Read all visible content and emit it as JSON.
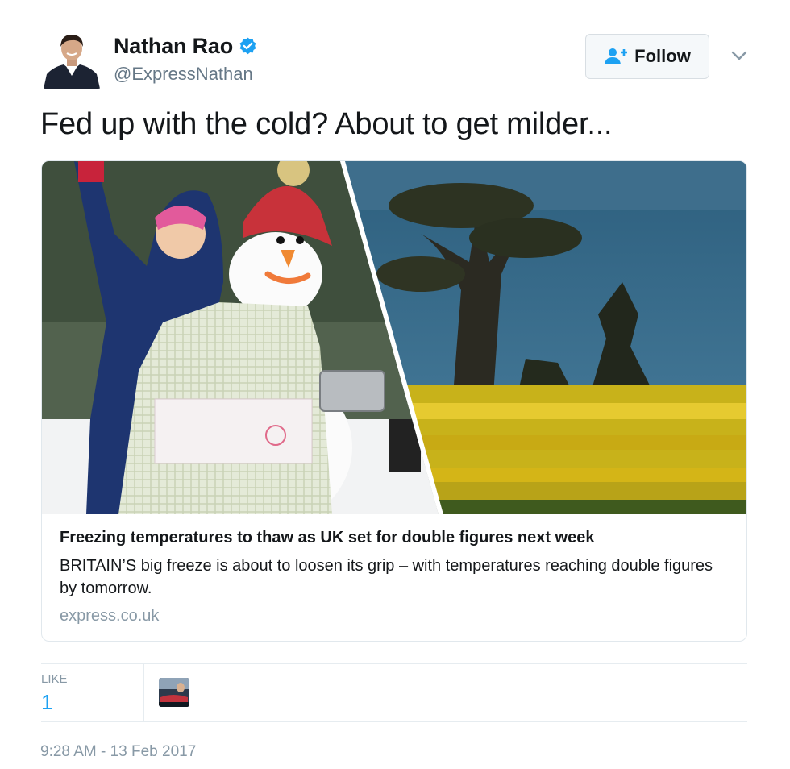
{
  "author": {
    "display_name": "Nathan Rao",
    "handle": "@ExpressNathan",
    "verified": true,
    "verified_color": "#1da1f2"
  },
  "follow_button": {
    "label": "Follow",
    "icon": "add-user-icon"
  },
  "tweet": {
    "text": "Fed up with the cold? About to get milder..."
  },
  "card": {
    "title": "Freezing temperatures to thaw as UK set for double figures next week",
    "description": "BRITAIN’S big freeze is about to loosen its grip – with temperatures reaching double figures by tomorrow.",
    "domain": "express.co.uk"
  },
  "stats": {
    "likes_label": "LIKE",
    "likes_count": "1"
  },
  "timestamp": "9:28 AM - 13 Feb 2017",
  "colors": {
    "accent": "#1da1f2",
    "muted": "#657786",
    "border": "#e1e8ed"
  }
}
